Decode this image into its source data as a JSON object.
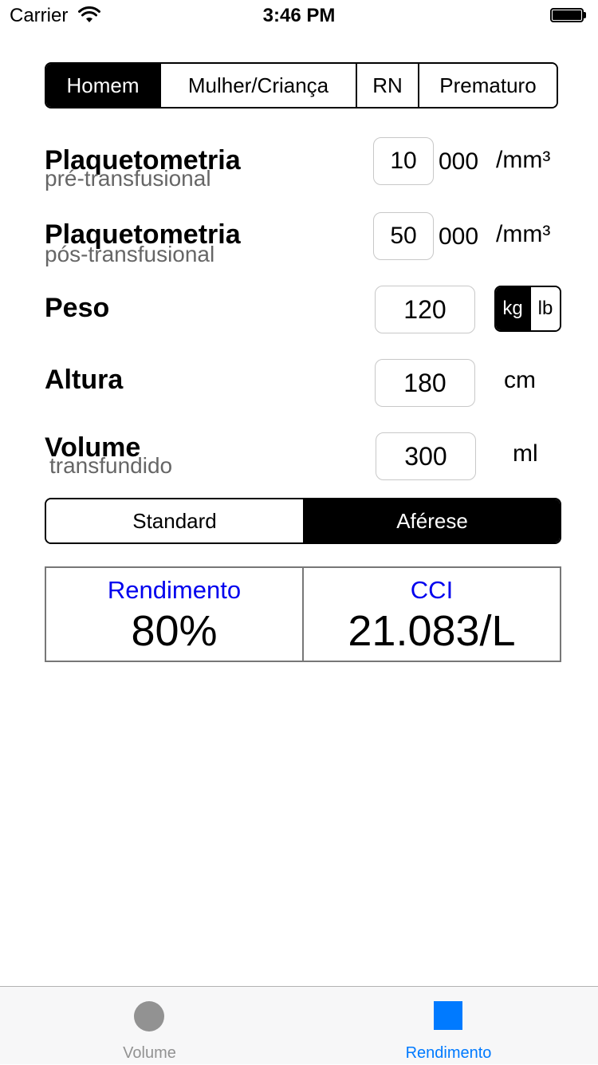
{
  "status": {
    "carrier": "Carrier",
    "time": "3:46 PM"
  },
  "patient_type": {
    "options": [
      "Homem",
      "Mulher/Criança",
      "RN",
      "Prematuro"
    ],
    "selected": "Homem"
  },
  "pre": {
    "label": "Plaquetometria",
    "sublabel": "pré-transfusional",
    "value": "10",
    "suffix": "000",
    "unit": "/mm³"
  },
  "post": {
    "label": "Plaquetometria",
    "sublabel": "pós-transfusional",
    "value": "50",
    "suffix": "000",
    "unit": "/mm³"
  },
  "weight": {
    "label": "Peso",
    "value": "120",
    "units": [
      "kg",
      "lb"
    ],
    "selected_unit": "kg"
  },
  "height": {
    "label": "Altura",
    "value": "180",
    "unit": "cm"
  },
  "volume": {
    "label": "Volume",
    "sublabel": "transfundido",
    "value": "300",
    "unit": "ml"
  },
  "transfusion_type": {
    "options": [
      "Standard",
      "Aférese"
    ],
    "selected": "Aférese"
  },
  "results": {
    "yield_title": "Rendimento",
    "yield_value": "80%",
    "cci_title": "CCI",
    "cci_value": "21.083/L"
  },
  "tabs": [
    {
      "label": "Volume",
      "icon": "circle-icon",
      "active": false
    },
    {
      "label": "Rendimento",
      "icon": "square-icon",
      "active": true
    }
  ],
  "colors": {
    "accent": "#007aff",
    "result_title": "#0000ee",
    "sublabel": "#666666",
    "inactive_tab": "#929292"
  }
}
